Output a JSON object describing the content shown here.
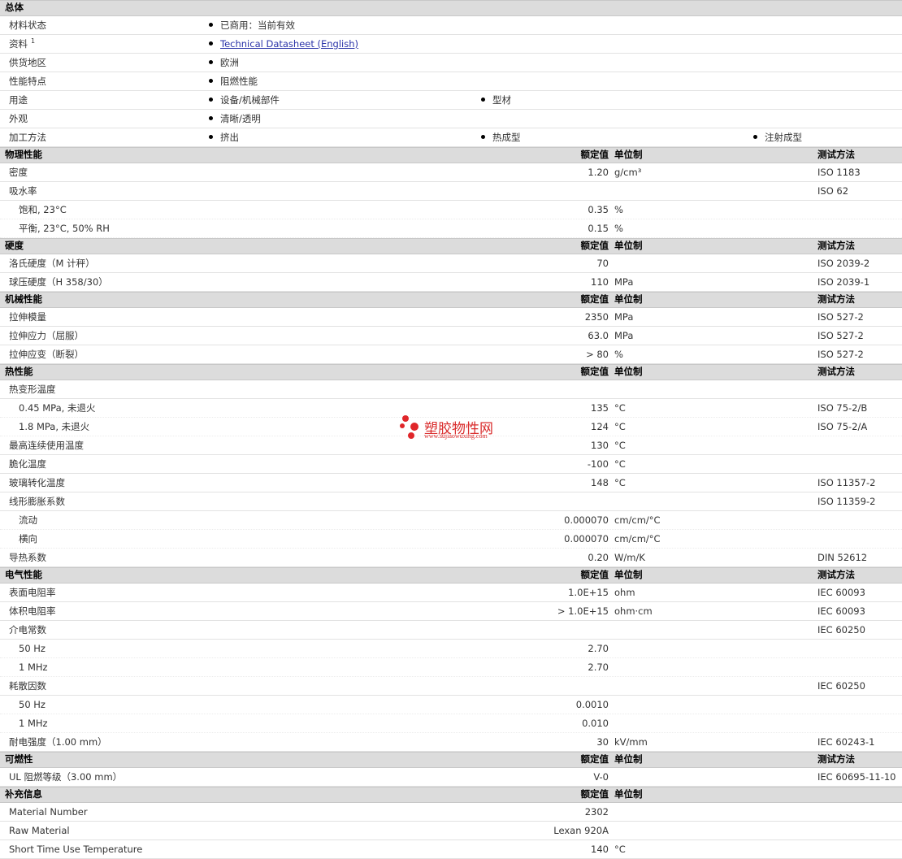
{
  "general": {
    "title": "总体",
    "material_status": {
      "label": "材料状态",
      "value": "已商用：当前有效"
    },
    "literature": {
      "label": "资料",
      "superscript": "1",
      "link": "Technical Datasheet (English)"
    },
    "supply_region": {
      "label": "供货地区",
      "value": "欧洲"
    },
    "features": {
      "label": "性能特点",
      "value": "阻燃性能"
    },
    "uses": {
      "label": "用途",
      "values": [
        "设备/机械部件",
        "型材"
      ]
    },
    "appearance": {
      "label": "外观",
      "value": "清晰/透明"
    },
    "processing": {
      "label": "加工方法",
      "values": [
        "挤出",
        "热成型",
        "注射成型"
      ]
    }
  },
  "headers": {
    "nominal": "额定值",
    "unit": "单位制",
    "test": "测试方法"
  },
  "physical": {
    "title": "物理性能",
    "rows": [
      {
        "label": "密度",
        "value": "1.20",
        "unit": "g/cm³",
        "test": "ISO 1183"
      },
      {
        "label": "吸水率",
        "value": "",
        "unit": "",
        "test": "ISO 62"
      },
      {
        "label": "饱和, 23°C",
        "value": "0.35",
        "unit": "%",
        "test": ""
      },
      {
        "label": "平衡, 23°C, 50% RH",
        "value": "0.15",
        "unit": "%",
        "test": ""
      }
    ]
  },
  "hardness": {
    "title": "硬度",
    "rows": [
      {
        "label": "洛氏硬度（M 计秤）",
        "value": "70",
        "unit": "",
        "test": "ISO 2039-2"
      },
      {
        "label": "球压硬度（H 358/30）",
        "value": "110",
        "unit": "MPa",
        "test": "ISO 2039-1"
      }
    ]
  },
  "mechanical": {
    "title": "机械性能",
    "rows": [
      {
        "label": "拉伸模量",
        "value": "2350",
        "unit": "MPa",
        "test": "ISO 527-2"
      },
      {
        "label": "拉伸应力（屈服）",
        "value": "63.0",
        "unit": "MPa",
        "test": "ISO 527-2"
      },
      {
        "label": "拉伸应变（断裂）",
        "value": "> 80",
        "unit": "%",
        "test": "ISO 527-2"
      }
    ]
  },
  "thermal": {
    "title": "热性能",
    "rows": [
      {
        "label": "热变形温度",
        "value": "",
        "unit": "",
        "test": ""
      },
      {
        "label": "0.45 MPa, 未退火",
        "value": "135",
        "unit": "°C",
        "test": "ISO 75-2/B"
      },
      {
        "label": "1.8 MPa, 未退火",
        "value": "124",
        "unit": "°C",
        "test": "ISO 75-2/A"
      },
      {
        "label": "最高连续使用温度",
        "value": "130",
        "unit": "°C",
        "test": ""
      },
      {
        "label": "脆化温度",
        "value": "-100",
        "unit": "°C",
        "test": ""
      },
      {
        "label": "玻璃转化温度",
        "value": "148",
        "unit": "°C",
        "test": "ISO 11357-2"
      },
      {
        "label": "线形膨胀系数",
        "value": "",
        "unit": "",
        "test": "ISO 11359-2"
      },
      {
        "label": "流动",
        "value": "0.000070",
        "unit": "cm/cm/°C",
        "test": ""
      },
      {
        "label": "横向",
        "value": "0.000070",
        "unit": "cm/cm/°C",
        "test": ""
      },
      {
        "label": "导热系数",
        "value": "0.20",
        "unit": "W/m/K",
        "test": "DIN 52612"
      }
    ]
  },
  "electrical": {
    "title": "电气性能",
    "rows": [
      {
        "label": "表面电阻率",
        "value": "1.0E+15",
        "unit": "ohm",
        "test": "IEC 60093"
      },
      {
        "label": "体积电阻率",
        "value": "> 1.0E+15",
        "unit": "ohm·cm",
        "test": "IEC 60093"
      },
      {
        "label": "介电常数",
        "value": "",
        "unit": "",
        "test": "IEC 60250"
      },
      {
        "label": "50 Hz",
        "value": "2.70",
        "unit": "",
        "test": ""
      },
      {
        "label": "1 MHz",
        "value": "2.70",
        "unit": "",
        "test": ""
      },
      {
        "label": "耗散因数",
        "value": "",
        "unit": "",
        "test": "IEC 60250"
      },
      {
        "label": "50 Hz",
        "value": "0.0010",
        "unit": "",
        "test": ""
      },
      {
        "label": "1 MHz",
        "value": "0.010",
        "unit": "",
        "test": ""
      },
      {
        "label": "耐电强度（1.00 mm）",
        "value": "30",
        "unit": "kV/mm",
        "test": "IEC 60243-1"
      }
    ]
  },
  "flammability": {
    "title": "可燃性",
    "rows": [
      {
        "label": "UL 阻燃等级（3.00 mm）",
        "value": "V-0",
        "unit": "",
        "test": "IEC 60695-11-10"
      }
    ]
  },
  "additional": {
    "title": "补充信息",
    "rows": [
      {
        "label": "Material Number",
        "value": "2302",
        "unit": "",
        "test": ""
      },
      {
        "label": "Raw Material",
        "value": "Lexan 920A",
        "unit": "",
        "test": ""
      },
      {
        "label": "Short Time Use Temperature",
        "value": "140",
        "unit": "°C",
        "test": ""
      }
    ]
  },
  "watermark": {
    "title": "塑胶物性网",
    "url": "www.sujiaowuxing.com",
    "color": "#e0262a"
  }
}
